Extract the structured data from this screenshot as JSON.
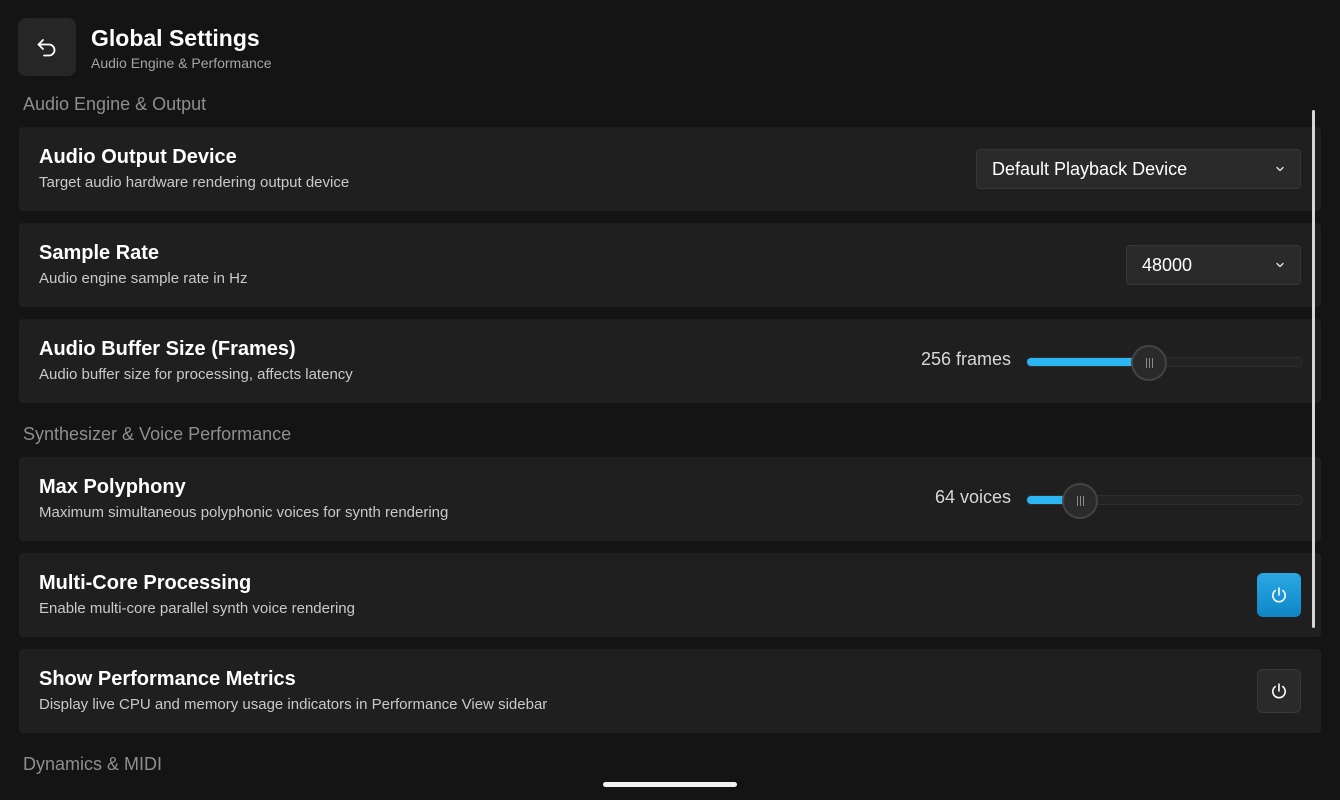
{
  "header": {
    "back_icon": "undo-arrow-icon",
    "title": "Global Settings",
    "subtitle": "Audio Engine & Performance"
  },
  "sections": {
    "audio_engine": "Audio Engine & Output",
    "synth": "Synthesizer & Voice Performance",
    "dynamics": "Dynamics & MIDI"
  },
  "settings": {
    "output_device": {
      "title": "Audio Output Device",
      "description": "Target audio hardware rendering output device",
      "value": "Default Playback Device",
      "icon": "chevron-down-icon"
    },
    "sample_rate": {
      "title": "Sample Rate",
      "description": "Audio engine sample rate in Hz",
      "value": "48000",
      "icon": "chevron-down-icon"
    },
    "buffer_size": {
      "title": "Audio Buffer Size (Frames)",
      "description": "Audio buffer size for processing, affects latency",
      "value_label": "256 frames",
      "level": 0.44
    },
    "polyphony": {
      "title": "Max Polyphony",
      "description": "Maximum simultaneous polyphonic voices for synth rendering",
      "value_label": "64 voices",
      "level": 0.19
    },
    "multicore": {
      "title": "Multi-Core Processing",
      "description": "Enable multi-core parallel synth voice rendering",
      "enabled": true,
      "icon": "power-icon"
    },
    "metrics": {
      "title": "Show Performance Metrics",
      "description": "Display live CPU and memory usage indicators in Performance View sidebar",
      "enabled": false,
      "icon": "power-icon"
    }
  },
  "colors": {
    "accent": "#2bb5f2",
    "background": "#141414",
    "card": "#1f1f1f"
  }
}
